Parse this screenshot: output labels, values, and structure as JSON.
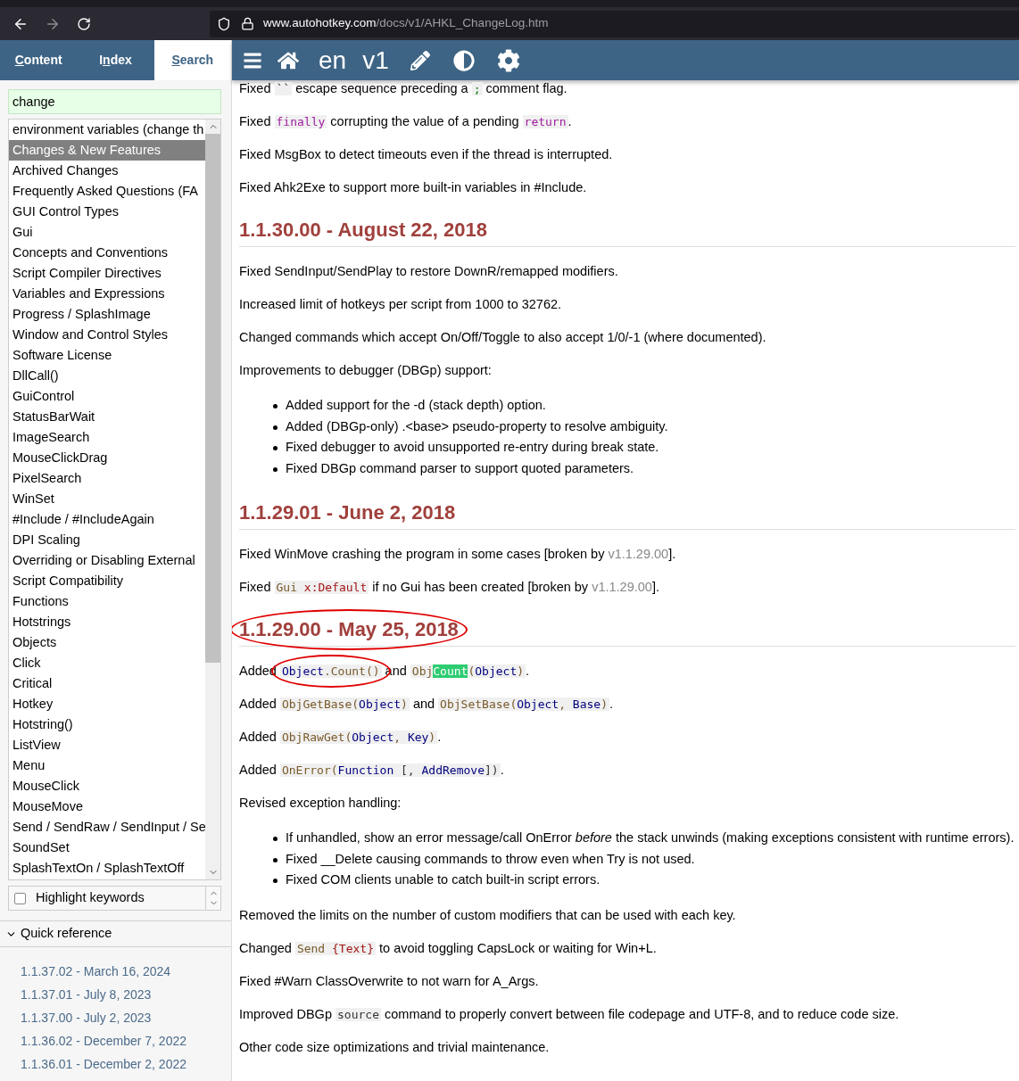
{
  "browser": {
    "url_host": "www.autohotkey.com",
    "url_path": "/docs/v1/AHKL_ChangeLog.htm",
    "forward_disabled": true
  },
  "sidebar": {
    "tabs": [
      {
        "key": "C",
        "after": "ontent",
        "selected": false
      },
      {
        "before": "I",
        "key": "n",
        "after": "dex",
        "selected": false
      },
      {
        "key": "S",
        "after": "earch",
        "selected": true
      }
    ],
    "search": {
      "value": "change"
    },
    "results": [
      {
        "text": "environment variables (change th",
        "selected": false
      },
      {
        "text": "Changes & New Features",
        "selected": true
      },
      {
        "text": "Archived Changes",
        "selected": false
      },
      {
        "text": "Frequently Asked Questions (FA",
        "selected": false
      },
      {
        "text": "GUI Control Types",
        "selected": false
      },
      {
        "text": "Gui",
        "selected": false
      },
      {
        "text": "Concepts and Conventions",
        "selected": false
      },
      {
        "text": "Script Compiler Directives",
        "selected": false
      },
      {
        "text": "Variables and Expressions",
        "selected": false
      },
      {
        "text": "Progress / SplashImage",
        "selected": false
      },
      {
        "text": "Window and Control Styles",
        "selected": false
      },
      {
        "text": "Software License",
        "selected": false
      },
      {
        "text": "DllCall()",
        "selected": false
      },
      {
        "text": "GuiControl",
        "selected": false
      },
      {
        "text": "StatusBarWait",
        "selected": false
      },
      {
        "text": "ImageSearch",
        "selected": false
      },
      {
        "text": "MouseClickDrag",
        "selected": false
      },
      {
        "text": "PixelSearch",
        "selected": false
      },
      {
        "text": "WinSet",
        "selected": false
      },
      {
        "text": "#Include / #IncludeAgain",
        "selected": false
      },
      {
        "text": "DPI Scaling",
        "selected": false
      },
      {
        "text": "Overriding or Disabling External",
        "selected": false
      },
      {
        "text": "Script Compatibility",
        "selected": false
      },
      {
        "text": "Functions",
        "selected": false
      },
      {
        "text": "Hotstrings",
        "selected": false
      },
      {
        "text": "Objects",
        "selected": false
      },
      {
        "text": "Click",
        "selected": false
      },
      {
        "text": "Critical",
        "selected": false
      },
      {
        "text": "Hotkey",
        "selected": false
      },
      {
        "text": "Hotstring()",
        "selected": false
      },
      {
        "text": "ListView",
        "selected": false
      },
      {
        "text": "Menu",
        "selected": false
      },
      {
        "text": "MouseClick",
        "selected": false
      },
      {
        "text": "MouseMove",
        "selected": false
      },
      {
        "text": "Send / SendRaw / SendInput / Se",
        "selected": false
      },
      {
        "text": "SoundSet",
        "selected": false
      },
      {
        "text": "SplashTextOn / SplashTextOff",
        "selected": false
      }
    ],
    "highlight": {
      "label": "Highlight keywords",
      "checked": false
    },
    "quick_reference": {
      "title": "Quick reference",
      "expanded": true,
      "links": [
        "1.1.37.02 - March 16, 2024",
        "1.1.37.01 - July 8, 2023",
        "1.1.37.00 - July 2, 2023",
        "1.1.36.02 - December 7, 2022",
        "1.1.36.01 - December 2, 2022"
      ]
    }
  },
  "toolbar": {
    "language": "en",
    "version": "v1"
  },
  "content": [
    {
      "kind": "p",
      "segments": [
        {
          "kind": "text",
          "text": "Fixed "
        },
        {
          "kind": "code",
          "circled": false,
          "tokens": [
            {
              "kind": "plain",
              "text": "``"
            }
          ]
        },
        {
          "kind": "text",
          "text": " escape sequence preceding a "
        },
        {
          "kind": "code",
          "circled": false,
          "tokens": [
            {
              "kind": "comment",
              "text": ";"
            }
          ]
        },
        {
          "kind": "text",
          "text": " comment flag."
        }
      ]
    },
    {
      "kind": "p",
      "segments": [
        {
          "kind": "text",
          "text": "Fixed "
        },
        {
          "kind": "code",
          "circled": false,
          "tokens": [
            {
              "kind": "keyword",
              "text": "finally"
            }
          ]
        },
        {
          "kind": "text",
          "text": " corrupting the value of a pending "
        },
        {
          "kind": "code",
          "circled": false,
          "tokens": [
            {
              "kind": "keyword",
              "text": "return"
            }
          ]
        },
        {
          "kind": "text",
          "text": "."
        }
      ]
    },
    {
      "kind": "p",
      "segments": [
        {
          "kind": "text",
          "text": "Fixed MsgBox to detect timeouts even if the thread is interrupted."
        }
      ]
    },
    {
      "kind": "p",
      "segments": [
        {
          "kind": "text",
          "text": "Fixed Ahk2Exe to support more built-in variables in #Include."
        }
      ]
    },
    {
      "kind": "heading",
      "text": "1.1.30.00 - August 22, 2018"
    },
    {
      "kind": "p",
      "segments": [
        {
          "kind": "text",
          "text": "Fixed SendInput/SendPlay to restore DownR/remapped modifiers."
        }
      ]
    },
    {
      "kind": "p",
      "segments": [
        {
          "kind": "text",
          "text": "Increased limit of hotkeys per script from 1000 to 32762."
        }
      ]
    },
    {
      "kind": "p",
      "segments": [
        {
          "kind": "text",
          "text": "Changed commands which accept On/Off/Toggle to also accept 1/0/-1 (where documented)."
        }
      ]
    },
    {
      "kind": "p",
      "segments": [
        {
          "kind": "text",
          "text": "Improvements to debugger (DBGp) support:"
        }
      ]
    },
    {
      "kind": "list",
      "items": [
        "Added support for the -d (stack depth) option.",
        "Added (DBGp-only) .<base> pseudo-property to resolve ambiguity.",
        "Fixed debugger to avoid unsupported re-entry during break state.",
        "Fixed DBGp command parser to support quoted parameters."
      ]
    },
    {
      "kind": "heading",
      "text": "1.1.29.01 - June 2, 2018"
    },
    {
      "kind": "p",
      "segments": [
        {
          "kind": "text",
          "text": "Fixed WinMove crashing the program in some cases [broken by "
        },
        {
          "kind": "version",
          "text": "v1.1.29.00"
        },
        {
          "kind": "text",
          "text": "]."
        }
      ]
    },
    {
      "kind": "p",
      "segments": [
        {
          "kind": "text",
          "text": "Fixed "
        },
        {
          "kind": "code",
          "circled": false,
          "tokens": [
            {
              "kind": "command",
              "text": "Gui "
            },
            {
              "kind": "string",
              "text": "x:Default"
            }
          ]
        },
        {
          "kind": "text",
          "text": " if no Gui has been created [broken by "
        },
        {
          "kind": "version",
          "text": "v1.1.29.00"
        },
        {
          "kind": "text",
          "text": "]."
        }
      ]
    },
    {
      "kind": "heading",
      "text": "1.1.29.00 - May 25, 2018",
      "circled": true
    },
    {
      "kind": "p",
      "segments": [
        {
          "kind": "text",
          "text": "Added "
        },
        {
          "kind": "code",
          "circled": true,
          "tokens": [
            {
              "kind": "variable",
              "text": "Object"
            },
            {
              "kind": "command",
              "text": ".Count()"
            }
          ]
        },
        {
          "kind": "text",
          "text": " and "
        },
        {
          "kind": "code",
          "circled": false,
          "tokens": [
            {
              "kind": "command",
              "text": "Obj"
            },
            {
              "kind": "match",
              "text": "Count"
            },
            {
              "kind": "command",
              "text": "("
            },
            {
              "kind": "variable",
              "text": "Object"
            },
            {
              "kind": "command",
              "text": ")"
            }
          ]
        },
        {
          "kind": "text",
          "text": "."
        }
      ]
    },
    {
      "kind": "p",
      "segments": [
        {
          "kind": "text",
          "text": "Added "
        },
        {
          "kind": "code",
          "circled": false,
          "tokens": [
            {
              "kind": "command",
              "text": "ObjGetBase("
            },
            {
              "kind": "variable",
              "text": "Object"
            },
            {
              "kind": "command",
              "text": ")"
            }
          ]
        },
        {
          "kind": "text",
          "text": " and "
        },
        {
          "kind": "code",
          "circled": false,
          "tokens": [
            {
              "kind": "command",
              "text": "ObjSetBase("
            },
            {
              "kind": "variable",
              "text": "Object"
            },
            {
              "kind": "command",
              "text": ", "
            },
            {
              "kind": "variable",
              "text": "Base"
            },
            {
              "kind": "command",
              "text": ")"
            }
          ]
        },
        {
          "kind": "text",
          "text": "."
        }
      ]
    },
    {
      "kind": "p",
      "segments": [
        {
          "kind": "text",
          "text": "Added "
        },
        {
          "kind": "code",
          "circled": false,
          "tokens": [
            {
              "kind": "command",
              "text": "ObjRawGet("
            },
            {
              "kind": "variable",
              "text": "Object"
            },
            {
              "kind": "command",
              "text": ", "
            },
            {
              "kind": "variable",
              "text": "Key"
            },
            {
              "kind": "command",
              "text": ")"
            }
          ]
        },
        {
          "kind": "text",
          "text": "."
        }
      ]
    },
    {
      "kind": "p",
      "segments": [
        {
          "kind": "text",
          "text": "Added "
        },
        {
          "kind": "code",
          "circled": false,
          "tokens": [
            {
              "kind": "command",
              "text": "OnError("
            },
            {
              "kind": "variable",
              "text": "Function"
            },
            {
              "kind": "plain",
              "text": " [, "
            },
            {
              "kind": "variable",
              "text": "AddRemove"
            },
            {
              "kind": "plain",
              "text": "])"
            }
          ]
        },
        {
          "kind": "text",
          "text": "."
        }
      ]
    },
    {
      "kind": "p",
      "segments": [
        {
          "kind": "text",
          "text": "Revised exception handling:"
        }
      ]
    },
    {
      "kind": "list",
      "items": [
        "If unhandled, show an error message/call OnError *before* the stack unwinds (making exceptions consistent with runtime errors).",
        "Fixed __Delete causing commands to throw even when Try is not used.",
        "Fixed COM clients unable to catch built-in script errors."
      ]
    },
    {
      "kind": "p",
      "segments": [
        {
          "kind": "text",
          "text": "Removed the limits on the number of custom modifiers that can be used with each key."
        }
      ]
    },
    {
      "kind": "p",
      "segments": [
        {
          "kind": "text",
          "text": "Changed "
        },
        {
          "kind": "code",
          "circled": false,
          "tokens": [
            {
              "kind": "command",
              "text": "Send "
            },
            {
              "kind": "string",
              "text": "{Text}"
            }
          ]
        },
        {
          "kind": "text",
          "text": " to avoid toggling CapsLock or waiting for Win+L."
        }
      ]
    },
    {
      "kind": "p",
      "segments": [
        {
          "kind": "text",
          "text": "Fixed #Warn ClassOverwrite to not warn for A_Args."
        }
      ]
    },
    {
      "kind": "p",
      "segments": [
        {
          "kind": "text",
          "text": "Improved DBGp "
        },
        {
          "kind": "code",
          "circled": false,
          "tokens": [
            {
              "kind": "plain",
              "text": "source"
            }
          ]
        },
        {
          "kind": "text",
          "text": " command to properly convert between file codepage and UTF-8, and to reduce code size."
        }
      ]
    },
    {
      "kind": "p",
      "segments": [
        {
          "kind": "text",
          "text": "Other code size optimizations and trivial maintenance."
        }
      ]
    }
  ]
}
